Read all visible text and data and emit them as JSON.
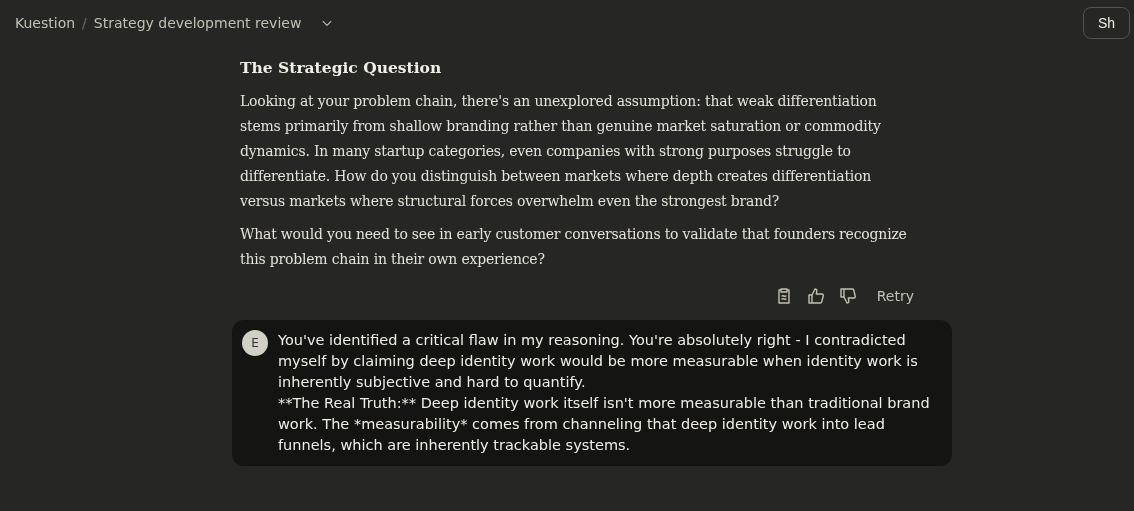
{
  "header": {
    "breadcrumb": [
      "Kuestion",
      "Strategy development review"
    ],
    "separator": "/",
    "share_button": "Sh"
  },
  "assistant_message": {
    "heading": "The Strategic Question",
    "paragraphs": [
      "Looking at your problem chain, there's an unexplored assumption: that weak differentiation stems primarily from shallow branding rather than genuine market saturation or commodity dynamics. In many startup categories, even companies with strong purposes struggle to differentiate. How do you distinguish between markets where depth creates differentiation versus markets where structural forces overwhelm even the strongest brand?",
      "What would you need to see in early customer conversations to validate that founders recognize this problem chain in their own experience?"
    ],
    "actions": {
      "retry": "Retry"
    }
  },
  "user_message": {
    "avatar": "E",
    "lines": [
      "You've identified a critical flaw in my reasoning. You're absolutely right - I contradicted myself by claiming deep identity work would be more measurable when identity work is inherently subjective and hard to quantify.",
      "**The Real Truth:** Deep identity work itself isn't more measurable than traditional brand work. The *measurability* comes from channeling that deep identity work into lead funnels, which are inherently trackable systems."
    ]
  }
}
